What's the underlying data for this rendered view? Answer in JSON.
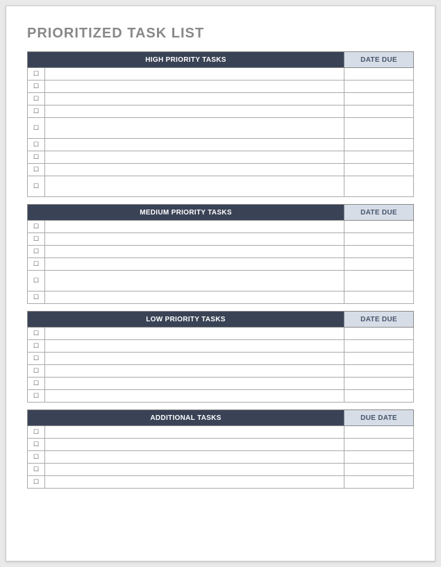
{
  "title": "PRIORITIZED TASK LIST",
  "sections": [
    {
      "task_header": "HIGH PRIORITY TASKS",
      "date_header": "DATE DUE",
      "rows": [
        {
          "checked": false,
          "task": "",
          "date": ""
        },
        {
          "checked": false,
          "task": "",
          "date": ""
        },
        {
          "checked": false,
          "task": "",
          "date": ""
        },
        {
          "checked": false,
          "task": "",
          "date": ""
        },
        {
          "checked": false,
          "task": "",
          "date": ""
        },
        {
          "checked": false,
          "task": "",
          "date": ""
        },
        {
          "checked": false,
          "task": "",
          "date": ""
        },
        {
          "checked": false,
          "task": "",
          "date": ""
        },
        {
          "checked": false,
          "task": "",
          "date": ""
        }
      ]
    },
    {
      "task_header": "MEDIUM PRIORITY TASKS",
      "date_header": "DATE DUE",
      "rows": [
        {
          "checked": false,
          "task": "",
          "date": ""
        },
        {
          "checked": false,
          "task": "",
          "date": ""
        },
        {
          "checked": false,
          "task": "",
          "date": ""
        },
        {
          "checked": false,
          "task": "",
          "date": ""
        },
        {
          "checked": false,
          "task": "",
          "date": ""
        },
        {
          "checked": false,
          "task": "",
          "date": ""
        }
      ]
    },
    {
      "task_header": "LOW PRIORITY TASKS",
      "date_header": "DATE DUE",
      "rows": [
        {
          "checked": false,
          "task": "",
          "date": ""
        },
        {
          "checked": false,
          "task": "",
          "date": ""
        },
        {
          "checked": false,
          "task": "",
          "date": ""
        },
        {
          "checked": false,
          "task": "",
          "date": ""
        },
        {
          "checked": false,
          "task": "",
          "date": ""
        },
        {
          "checked": false,
          "task": "",
          "date": ""
        }
      ]
    },
    {
      "task_header": "ADDITIONAL TASKS",
      "date_header": "DUE DATE",
      "rows": [
        {
          "checked": false,
          "task": "",
          "date": ""
        },
        {
          "checked": false,
          "task": "",
          "date": ""
        },
        {
          "checked": false,
          "task": "",
          "date": ""
        },
        {
          "checked": false,
          "task": "",
          "date": ""
        },
        {
          "checked": false,
          "task": "",
          "date": ""
        }
      ]
    }
  ]
}
